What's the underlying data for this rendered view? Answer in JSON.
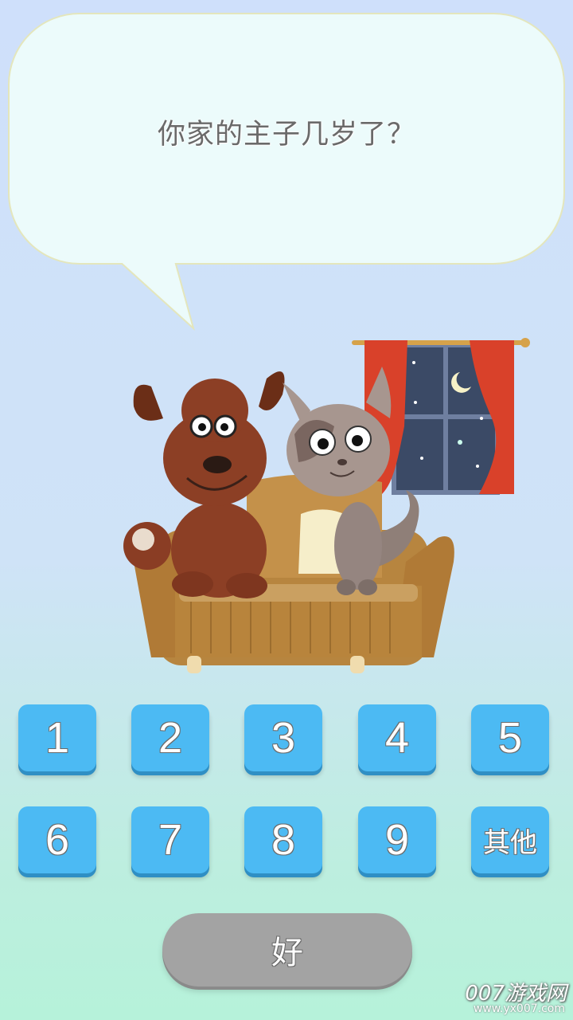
{
  "question": {
    "text": "你家的主子几岁了？"
  },
  "buttons": {
    "b1": "1",
    "b2": "2",
    "b3": "3",
    "b4": "4",
    "b5": "5",
    "b6": "6",
    "b7": "7",
    "b8": "8",
    "b9": "9",
    "other": "其他"
  },
  "confirm": {
    "label": "好"
  },
  "watermark": {
    "main": "007游戏网",
    "sub": "www.yx007.com"
  },
  "colors": {
    "button_blue": "#4cbaf3",
    "confirm_gray": "#a3a3a3",
    "bubble": "#ecfbfb"
  }
}
